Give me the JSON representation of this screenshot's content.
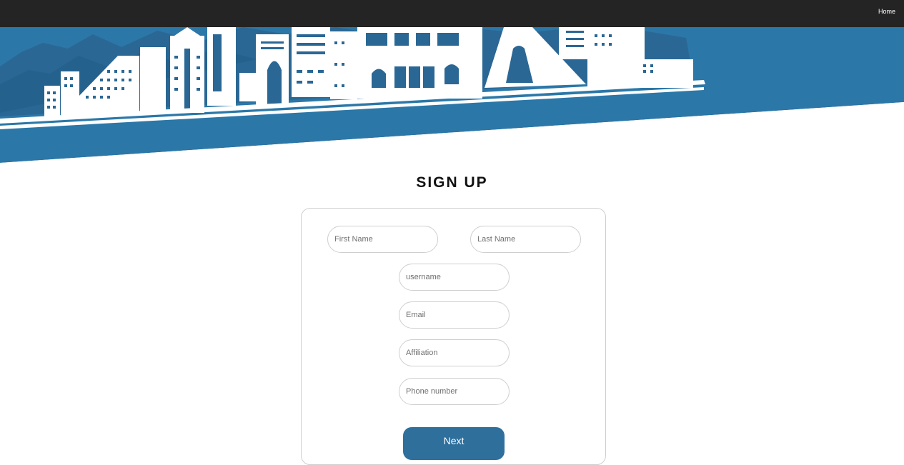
{
  "nav": {
    "home_label": "Home"
  },
  "page": {
    "title": "SIGN UP"
  },
  "form": {
    "first_name_placeholder": "First Name",
    "last_name_placeholder": "Last Name",
    "username_placeholder": "username",
    "email_placeholder": "Email",
    "affiliation_placeholder": "Affiliation",
    "phone_placeholder": "Phone number",
    "next_label": "Next"
  },
  "colors": {
    "topbar": "#242424",
    "banner_blue": "#2b77a8",
    "mountain_blue": "#2a6794",
    "accent_dark": "#0f4d78",
    "button": "#2e6f9c"
  }
}
